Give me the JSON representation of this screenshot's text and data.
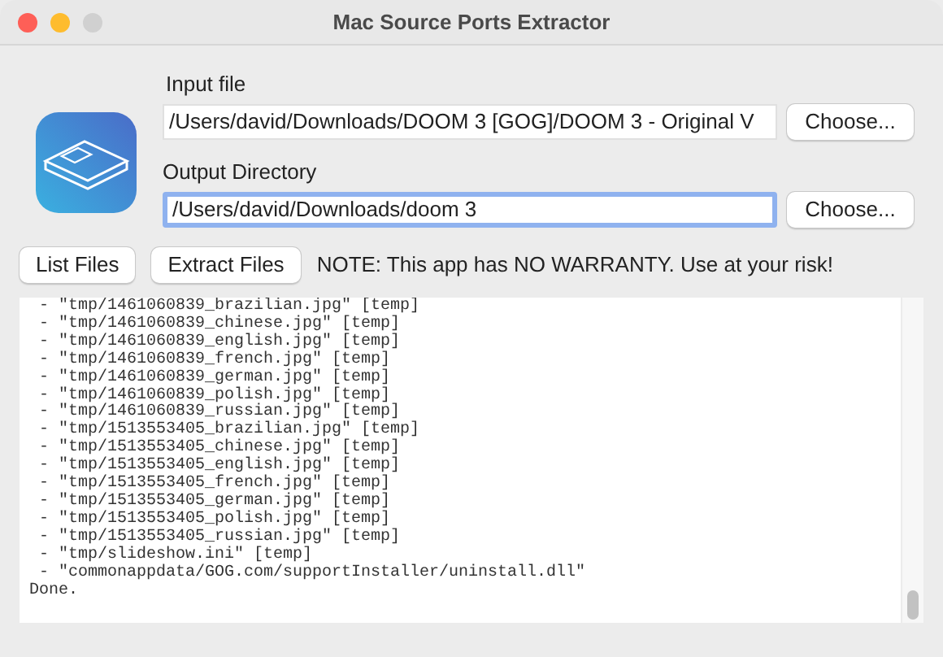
{
  "window": {
    "title": "Mac Source Ports Extractor"
  },
  "input_file": {
    "label": "Input file",
    "value": "/Users/david/Downloads/DOOM 3 [GOG]/DOOM 3 - Original V",
    "button": "Choose...",
    "focused": false
  },
  "output_directory": {
    "label": "Output Directory",
    "value": "/Users/david/Downloads/doom 3",
    "button": "Choose...",
    "focused": true
  },
  "buttons": [
    "List Files",
    "Extract Files"
  ],
  "note": "NOTE: This app has NO WARRANTY. Use at your risk!",
  "log": [
    " - \"tmp/1461060839_brazilian.jpg\" [temp]",
    " - \"tmp/1461060839_chinese.jpg\" [temp]",
    " - \"tmp/1461060839_english.jpg\" [temp]",
    " - \"tmp/1461060839_french.jpg\" [temp]",
    " - \"tmp/1461060839_german.jpg\" [temp]",
    " - \"tmp/1461060839_polish.jpg\" [temp]",
    " - \"tmp/1461060839_russian.jpg\" [temp]",
    " - \"tmp/1513553405_brazilian.jpg\" [temp]",
    " - \"tmp/1513553405_chinese.jpg\" [temp]",
    " - \"tmp/1513553405_english.jpg\" [temp]",
    " - \"tmp/1513553405_french.jpg\" [temp]",
    " - \"tmp/1513553405_german.jpg\" [temp]",
    " - \"tmp/1513553405_polish.jpg\" [temp]",
    " - \"tmp/1513553405_russian.jpg\" [temp]",
    " - \"tmp/slideshow.ini\" [temp]",
    " - \"commonappdata/GOG.com/supportInstaller/uninstall.dll\"",
    "Done."
  ]
}
